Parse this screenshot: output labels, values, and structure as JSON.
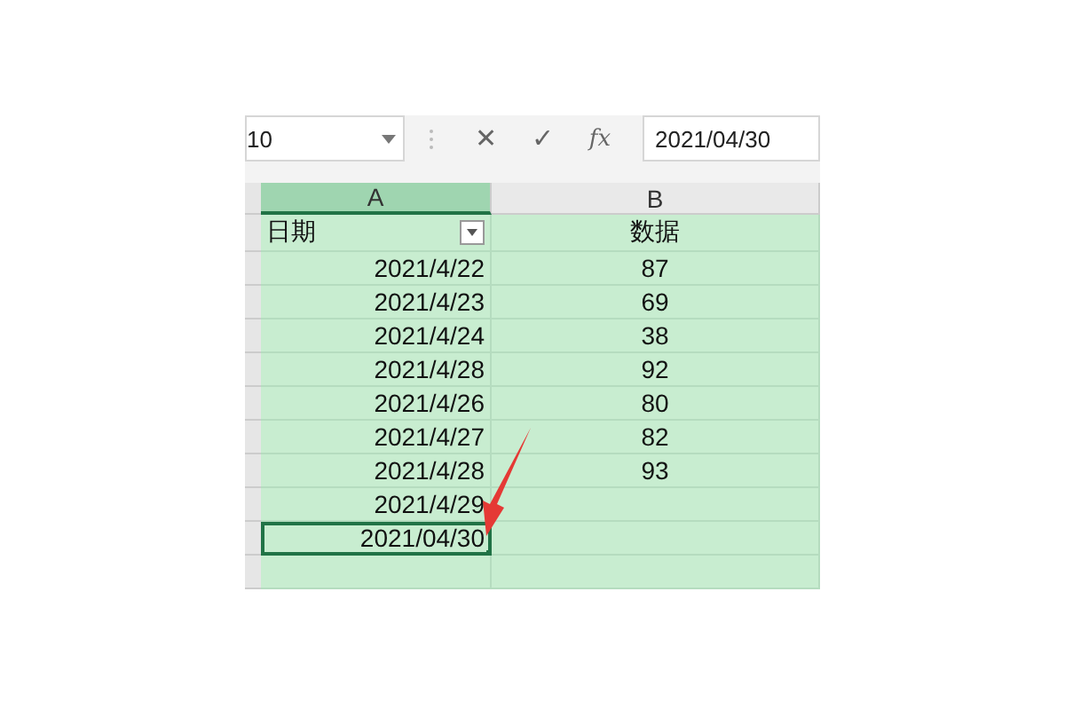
{
  "formula_bar": {
    "name_box": "10",
    "cancel": "✕",
    "enter": "✓",
    "function": "fx",
    "value": "2021/04/30"
  },
  "columns": [
    "A",
    "B"
  ],
  "header_row": {
    "date": "日期",
    "data": "数据"
  },
  "rows": [
    {
      "date": "2021/4/22",
      "value": "87",
      "selected": false
    },
    {
      "date": "2021/4/23",
      "value": "69",
      "selected": false
    },
    {
      "date": "2021/4/24",
      "value": "38",
      "selected": false
    },
    {
      "date": "2021/4/28",
      "value": "92",
      "selected": false
    },
    {
      "date": "2021/4/26",
      "value": "80",
      "selected": false
    },
    {
      "date": "2021/4/27",
      "value": "82",
      "selected": false
    },
    {
      "date": "2021/4/28",
      "value": "93",
      "selected": false
    },
    {
      "date": "2021/4/29",
      "selected": false
    },
    {
      "date": "2021/04/30",
      "selected": true
    },
    {
      "selected": false
    }
  ]
}
